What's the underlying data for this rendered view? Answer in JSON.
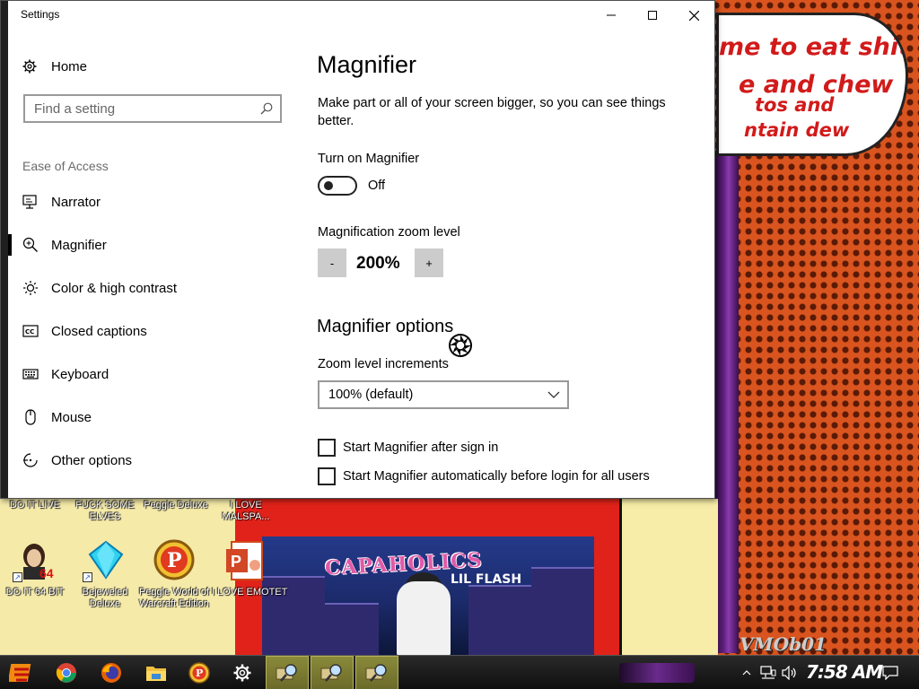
{
  "window": {
    "title": "Settings",
    "minimize_label": "",
    "maximize_label": "",
    "close_label": ""
  },
  "nav": {
    "home_label": "Home",
    "search_placeholder": "Find a setting",
    "section_label": "Ease of Access",
    "items": [
      {
        "label": "Narrator",
        "icon": "narrator-icon"
      },
      {
        "label": "Magnifier",
        "icon": "magnifier-icon",
        "selected": true
      },
      {
        "label": "Color & high contrast",
        "icon": "brightness-icon"
      },
      {
        "label": "Closed captions",
        "icon": "closed-captions-icon"
      },
      {
        "label": "Keyboard",
        "icon": "keyboard-icon"
      },
      {
        "label": "Mouse",
        "icon": "mouse-icon"
      },
      {
        "label": "Other options",
        "icon": "other-options-icon"
      }
    ]
  },
  "content": {
    "title": "Magnifier",
    "description": "Make part or all of your screen bigger, so you can see things better.",
    "turn_on_label": "Turn on Magnifier",
    "toggle_state": "Off",
    "zoom_label": "Magnification zoom level",
    "zoom_minus": "-",
    "zoom_value": "200%",
    "zoom_plus": "+",
    "options_heading": "Magnifier options",
    "increments_label": "Zoom level increments",
    "increments_value": "100% (default)",
    "check_after_sign_in": "Start Magnifier after sign in",
    "check_before_login": "Start Magnifier automatically before login for all users"
  },
  "desktop": {
    "bubble_lines": [
      "me to eat shit",
      "e and chew",
      "tos and",
      "ntain dew"
    ],
    "top_labels": [
      "DO IT LIVE",
      "FUCK SOME ELVES",
      "Peggle Deluxe",
      "I LOVE MALSPA..."
    ],
    "icons": [
      {
        "label": "DO IT 64 BIT",
        "icon": "portrait-icon"
      },
      {
        "label": "Bejeweled Deluxe",
        "icon": "gem-icon"
      },
      {
        "label": "Peggle World of Warcraft Edition",
        "icon": "peggle-icon"
      },
      {
        "label": "I LOVE EMOTET",
        "icon": "powerpoint-icon"
      }
    ],
    "album_title": "CAPAHOLICS",
    "album_artist": "LIL FLASH",
    "watermark": "VMOb01"
  },
  "taskbar": {
    "items": [
      "start-icon",
      "chrome-icon",
      "firefox-icon",
      "file-explorer-icon",
      "peggle-icon",
      "settings-icon",
      "magnifier-app-icon",
      "magnifier-app-icon",
      "magnifier-app-icon"
    ],
    "clock": "7:58 AM"
  },
  "colors": {
    "accent": "#000000",
    "wallpaper_orange": "#d9541e",
    "bubble_text": "#d21a1a"
  }
}
